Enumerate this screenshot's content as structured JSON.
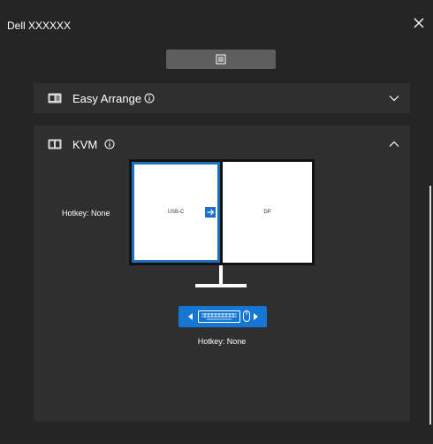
{
  "window": {
    "title": "Dell XXXXXX"
  },
  "panels": {
    "easy_arrange": {
      "title": "Easy Arrange"
    },
    "kvm": {
      "title": "KVM",
      "hotkey_left": "Hotkey: None",
      "hotkey_bottom": "Hotkey: None",
      "screens": {
        "left": "USB-C",
        "right": "DP"
      }
    }
  },
  "colors": {
    "background": "#252525",
    "panel": "#2f2f2f",
    "accent": "#1677d2",
    "menu_button": "#5e5e5e"
  },
  "icons": {
    "close": "close-icon",
    "menu": "menu-list-icon",
    "easy_arrange": "easy-arrange-icon",
    "kvm": "kvm-icon",
    "info": "info-icon",
    "chevron_down": "chevron-down-icon",
    "chevron_up": "chevron-up-icon",
    "switch_arrow": "arrow-right-icon",
    "keyboard": "keyboard-icon",
    "mouse": "mouse-icon"
  }
}
